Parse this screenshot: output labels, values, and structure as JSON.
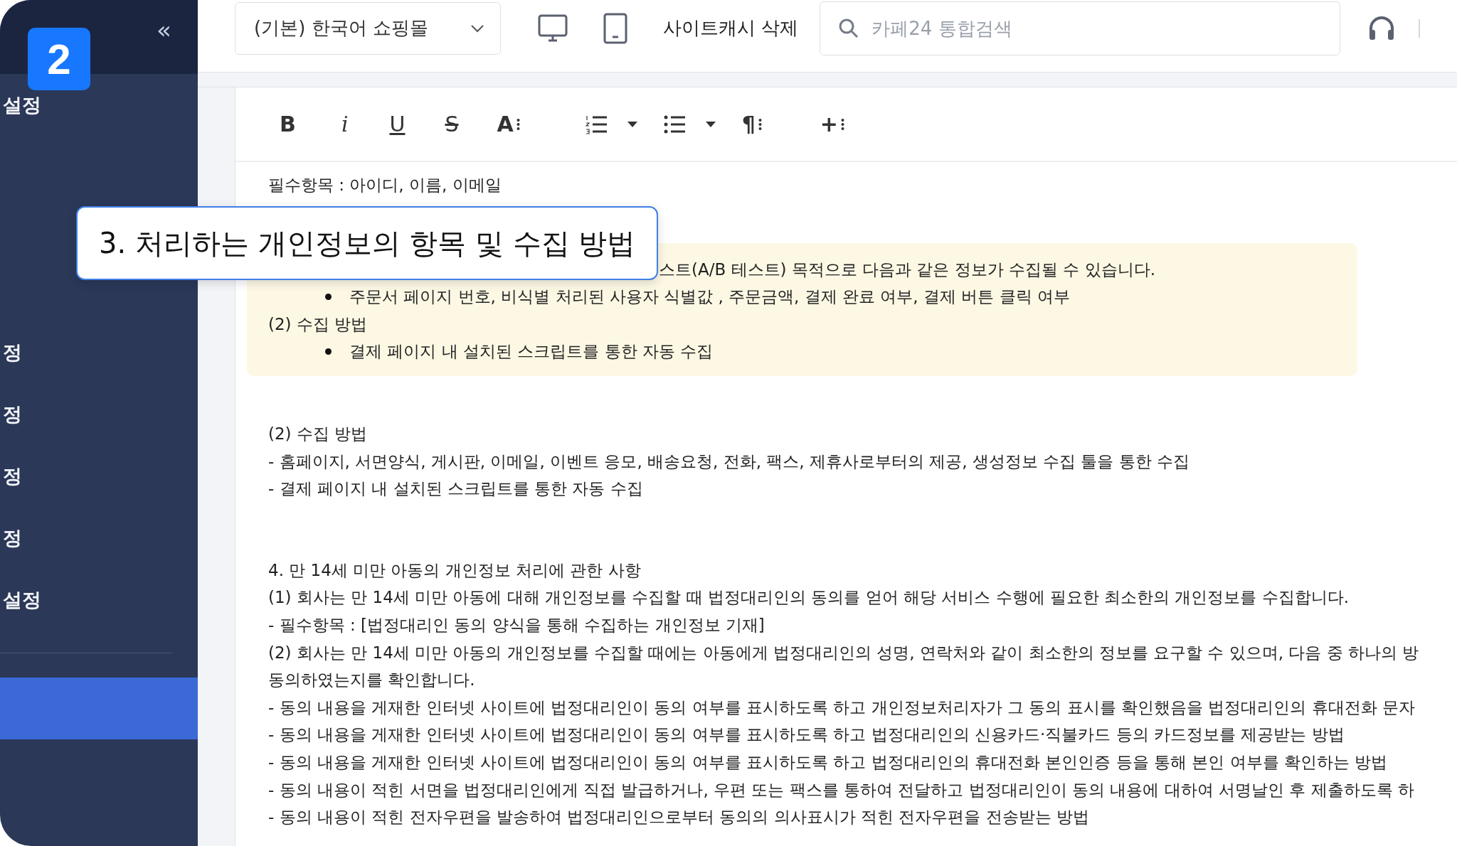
{
  "sidebar": {
    "badge": "2",
    "collapse": "«",
    "items": [
      {
        "label": "설정",
        "selected": false
      },
      {
        "selected": false
      },
      {
        "selected": false
      },
      {
        "selected": false
      },
      {
        "label": "정",
        "selected": false
      },
      {
        "label": "정",
        "selected": false
      },
      {
        "label": "정",
        "selected": false
      },
      {
        "label": "정",
        "selected": false
      },
      {
        "label": "설정",
        "selected": false
      },
      {
        "selected": true
      },
      {
        "selected": false
      }
    ]
  },
  "topbar": {
    "shop_select": {
      "value": "(기본) 한국어 쇼핑몰"
    },
    "cache_button": "사이트캐시 삭제",
    "search": {
      "placeholder": "카페24 통합검색"
    }
  },
  "toolbar": [
    {
      "kind": "bold",
      "label": "B"
    },
    {
      "kind": "italic",
      "label": "i"
    },
    {
      "kind": "underline",
      "label": "U"
    },
    {
      "kind": "strike",
      "label": "S"
    },
    {
      "kind": "fontsize",
      "label": "A"
    },
    {
      "kind": "ordered-list"
    },
    {
      "kind": "bullet-list"
    },
    {
      "kind": "paragraph",
      "label": "¶"
    },
    {
      "kind": "insert",
      "label": "+"
    }
  ],
  "callout": {
    "text": "3. 처리하는 개인정보의 항목 및 수집 방법"
  },
  "document": [
    {
      "kind": "paragraph",
      "lines": [
        {
          "kind": "plain",
          "text": "필수항목 : 아이디, 이름, 이메일"
        }
      ]
    },
    {
      "kind": "highlight",
      "lines": [
        {
          "kind": "covered",
          "text": "스트(A/B 테스트) 목적으로 다음과 같은 정보가 수집될 수 있습니다."
        },
        {
          "kind": "bullet",
          "text": "주문서 페이지 번호, 비식별 처리된 사용자 식별값 , 주문금액, 결제 완료 여부, 결제 버튼 클릭 여부"
        },
        {
          "kind": "plain",
          "text": "(2) 수집 방법"
        },
        {
          "kind": "bullet",
          "text": "결제 페이지 내 설치된 스크립트를 통한 자동 수집"
        }
      ]
    },
    {
      "kind": "paragraph",
      "lines": [
        {
          "kind": "plain",
          "text": "(2) 수집 방법"
        },
        {
          "kind": "plain",
          "text": "- 홈페이지, 서면양식, 게시판, 이메일, 이벤트 응모, 배송요청, 전화, 팩스, 제휴사로부터의 제공, 생성정보 수집 툴을 통한 수집"
        },
        {
          "kind": "plain",
          "text": "- 결제 페이지 내 설치된 스크립트를 통한 자동 수집"
        }
      ]
    },
    {
      "kind": "section",
      "lines": [
        {
          "kind": "plain",
          "text": "4. 만 14세 미만 아동의 개인정보 처리에 관한 사항"
        },
        {
          "kind": "plain",
          "text": "(1) 회사는 만 14세 미만 아동에 대해 개인정보를 수집할 때 법정대리인의 동의를 얻어 해당 서비스 수행에 필요한 최소한의 개인정보를 수집합니다."
        },
        {
          "kind": "plain",
          "text": "- 필수항목 : [법정대리인 동의 양식을 통해 수집하는 개인정보 기재]"
        },
        {
          "kind": "plain",
          "text": "(2) 회사는 만 14세 미만 아동의 개인정보를 수집할 때에는 아동에게 법정대리인의 성명, 연락처와 같이 최소한의 정보를 요구할 수 있으며, 다음 중 하나의 방"
        },
        {
          "kind": "plain",
          "text": "동의하였는지를 확인합니다."
        },
        {
          "kind": "plain",
          "text": "- 동의 내용을 게재한 인터넷 사이트에 법정대리인이 동의 여부를 표시하도록 하고 개인정보처리자가 그 동의 표시를 확인했음을 법정대리인의 휴대전화 문자"
        },
        {
          "kind": "plain",
          "text": "- 동의 내용을 게재한 인터넷 사이트에 법정대리인이 동의 여부를 표시하도록 하고 법정대리인의 신용카드·직불카드 등의 카드정보를 제공받는 방법"
        },
        {
          "kind": "plain",
          "text": "- 동의 내용을 게재한 인터넷 사이트에 법정대리인이 동의 여부를 표시하도록 하고 법정대리인의 휴대전화 본인인증 등을 통해 본인 여부를 확인하는 방법"
        },
        {
          "kind": "plain",
          "text": "- 동의 내용이 적힌 서면을 법정대리인에게 직접 발급하거나, 우편 또는 팩스를 통하여 전달하고 법정대리인이 동의 내용에 대하여 서명날인 후 제출하도록 하"
        },
        {
          "kind": "plain",
          "text": "- 동의 내용이 적힌 전자우편을 발송하여 법정대리인으로부터 동의의 의사표시가 적힌 전자우편을 전송받는 방법"
        }
      ]
    }
  ]
}
